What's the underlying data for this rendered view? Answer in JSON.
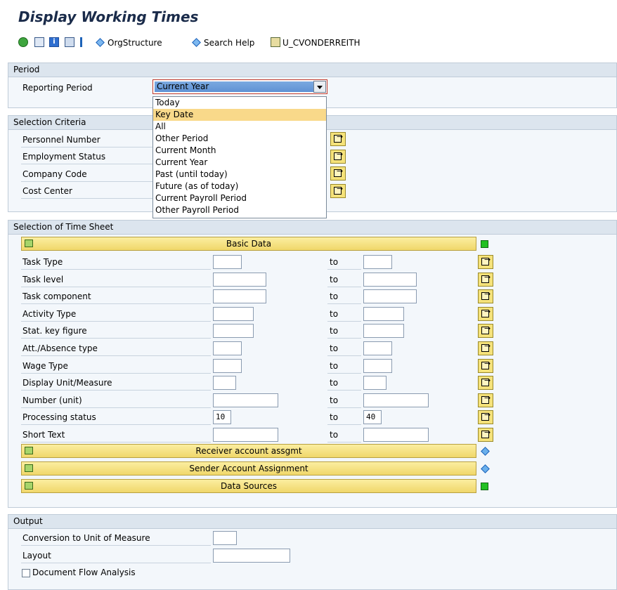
{
  "header": {
    "title": "Display Working Times"
  },
  "toolbar": {
    "orgstructure": "OrgStructure",
    "search_help": "Search Help",
    "user": "U_CVONDERREITH"
  },
  "period": {
    "title": "Period",
    "reporting_label": "Reporting Period",
    "selected": "Current Year",
    "options": [
      "Today",
      "Key Date",
      "All",
      "Other Period",
      "Current Month",
      "Current Year",
      "Past (until today)",
      "Future (as of today)",
      "Current Payroll Period",
      "Other Payroll Period"
    ]
  },
  "selection_criteria": {
    "title": "Selection Criteria",
    "fields": [
      "Personnel Number",
      "Employment Status",
      "Company Code",
      "Cost Center"
    ]
  },
  "timesheet": {
    "title": "Selection of Time Sheet",
    "basic_data": "Basic Data",
    "to": "to",
    "rows": [
      {
        "label": "Task Type",
        "from": "",
        "to": ""
      },
      {
        "label": "Task level",
        "from": "",
        "to": ""
      },
      {
        "label": "Task component",
        "from": "",
        "to": ""
      },
      {
        "label": "Activity Type",
        "from": "",
        "to": ""
      },
      {
        "label": "Stat. key figure",
        "from": "",
        "to": ""
      },
      {
        "label": "Att./Absence type",
        "from": "",
        "to": ""
      },
      {
        "label": "Wage Type",
        "from": "",
        "to": ""
      },
      {
        "label": "Display Unit/Measure",
        "from": "",
        "to": ""
      },
      {
        "label": "Number (unit)",
        "from": "",
        "to": ""
      },
      {
        "label": "Processing status",
        "from": "10",
        "to": "40"
      },
      {
        "label": "Short Text",
        "from": "",
        "to": ""
      }
    ],
    "receiver": "Receiver account assgmt",
    "sender": "Sender Account Assignment",
    "sources": "Data Sources"
  },
  "output": {
    "title": "Output",
    "conversion": "Conversion to Unit of Measure",
    "layout": "Layout",
    "doc_flow": "Document Flow Analysis"
  },
  "colors": {
    "status_green": "#22c022",
    "section_yellow": "#f0d76a",
    "panel_bg": "#f3f7fb"
  }
}
